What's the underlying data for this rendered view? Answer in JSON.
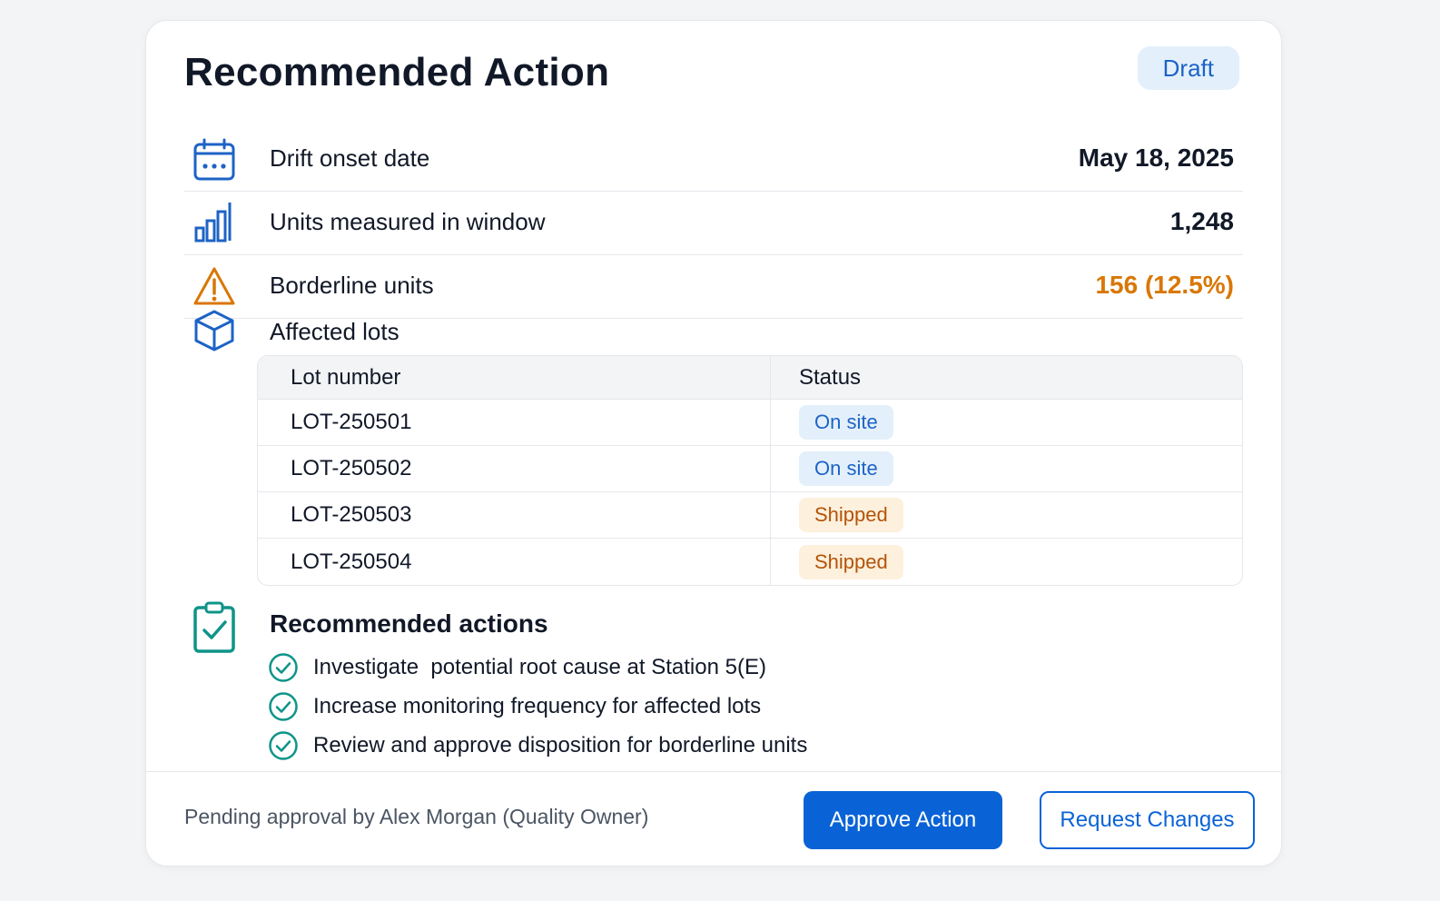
{
  "card": {
    "title": "Recommended Action",
    "status_badge": "Draft"
  },
  "metrics": [
    {
      "icon": "calendar-icon",
      "label": "Drift onset date",
      "value": "May 18, 2025"
    },
    {
      "icon": "bar-chart-icon",
      "label": "Units measured in window",
      "value": "1,248"
    },
    {
      "icon": "warning-icon",
      "label": "Borderline units",
      "value": "156 (12.5%)"
    }
  ],
  "lots": {
    "icon": "box-icon",
    "label": "Affected lots",
    "columns": [
      "Lot number",
      "Status"
    ],
    "rows": [
      {
        "lot": "LOT-250501",
        "status": "On site"
      },
      {
        "lot": "LOT-250502",
        "status": "On site"
      },
      {
        "lot": "LOT-250503",
        "status": "Shipped"
      },
      {
        "lot": "LOT-250504",
        "status": "Shipped"
      }
    ]
  },
  "recommended": {
    "icon": "clipboard-check-icon",
    "title": "Recommended actions",
    "items": [
      "Investigate  potential root cause at Station 5(E)",
      "Increase monitoring frequency for affected lots",
      "Review and approve disposition for borderline units"
    ]
  },
  "footer": {
    "pending_text": "Pending approval by Alex Morgan (Quality Owner)",
    "approve_label": "Approve Action",
    "request_changes_label": "Request Changes"
  },
  "colors": {
    "accent": "#0a63d6",
    "warning": "#d97706",
    "success": "#0f9488",
    "onsite_bg": "#e3f0fb",
    "shipped_bg": "#fdf0dc"
  }
}
